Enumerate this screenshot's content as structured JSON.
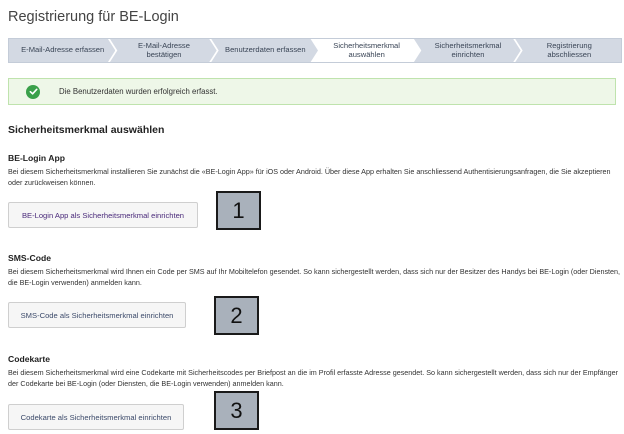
{
  "page": {
    "title": "Registrierung für BE-Login"
  },
  "stepper": {
    "steps": [
      {
        "label": "E-Mail-Adresse erfassen"
      },
      {
        "label": "E-Mail-Adresse bestätigen"
      },
      {
        "label": "Benutzerdaten erfassen"
      },
      {
        "label": "Sicherheitsmerkmal auswählen"
      },
      {
        "label": "Sicherheitsmerkmal einrichten"
      },
      {
        "label": "Registrierung abschliessen"
      }
    ],
    "active_step": 3
  },
  "alert": {
    "text": "Die Benutzerdaten wurden erfolgreich erfasst.",
    "icon": "check-circle-icon",
    "color": "#3aa04a"
  },
  "main": {
    "title": "Sicherheitsmerkmal auswählen",
    "options": [
      {
        "heading": "BE-Login App",
        "description": "Bei diesem Sicherheitsmerkmal installieren Sie zunächst die «BE-Login App» für iOS oder Android. Über diese App erhalten Sie anschliessend Authentisierungsanfragen, die Sie akzeptieren oder zurückweisen können.",
        "button": "BE-Login App als Sicherheitsmerkmal einrichten",
        "marker": "1"
      },
      {
        "heading": "SMS-Code",
        "description": "Bei diesem Sicherheitsmerkmal wird Ihnen ein Code per SMS auf Ihr Mobiltelefon gesendet. So kann sichergestellt werden, dass sich nur der Besitzer des Handys bei BE-Login (oder Diensten, die BE-Login verwenden) anmelden kann.",
        "button": "SMS-Code als Sicherheitsmerkmal einrichten",
        "marker": "2"
      },
      {
        "heading": "Codekarte",
        "description": "Bei diesem Sicherheitsmerkmal wird eine Codekarte mit Sicherheitscodes per Briefpost an die im Profil erfasste Adresse gesendet. So kann sichergestellt werden, dass sich nur der Empfänger der Codekarte bei BE-Login (oder Diensten, die BE-Login verwenden) anmelden kann.",
        "button": "Codekarte als Sicherheitsmerkmal einrichten",
        "marker": "3"
      }
    ]
  }
}
